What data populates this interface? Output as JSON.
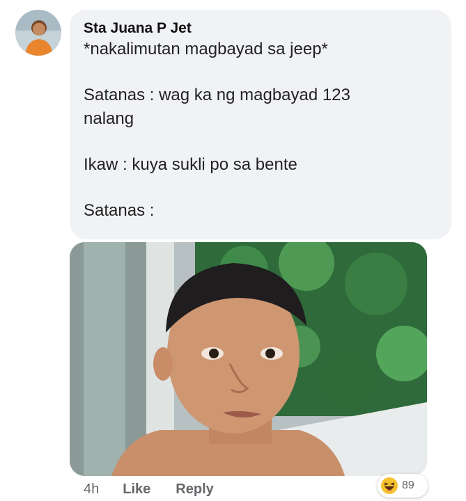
{
  "comment": {
    "author": "Sta Juana P Jet",
    "lines": [
      "*nakalimutan magbayad sa jeep*",
      "",
      "Satanas : wag ka ng magbayad 123",
      "nalang",
      "",
      "Ikaw : kuya sukli po sa bente",
      "",
      "Satanas :"
    ],
    "attachment_icon": "photo-of-shocked-boy"
  },
  "actions": {
    "time": "4h",
    "like_label": "Like",
    "reply_label": "Reply"
  },
  "reactions": {
    "icon": "haha-emoji-icon",
    "count": "89"
  },
  "colors": {
    "bubble_bg": "#f0f2f5",
    "meta_text": "#65676b",
    "haha_yellow": "#f7c22d"
  }
}
